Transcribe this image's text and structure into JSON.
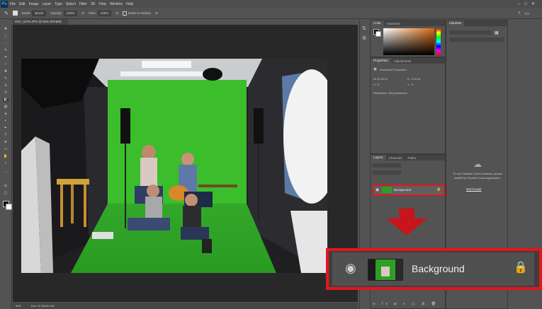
{
  "app": {
    "logo": "Ps"
  },
  "menu": [
    "File",
    "Edit",
    "Image",
    "Layer",
    "Type",
    "Select",
    "Filter",
    "3D",
    "View",
    "Window",
    "Help"
  ],
  "window_controls": [
    "–",
    "□",
    "✕"
  ],
  "options_bar": {
    "mode_label": "Mode:",
    "mode_value": "Brush",
    "opacity_label": "Opacity:",
    "opacity_value": "100%",
    "flow_label": "Flow:",
    "flow_value": "100%",
    "erase_history": "Erase to History"
  },
  "document": {
    "tab_title": "DSC_5275.JPG @ 50% (RGB/8)",
    "zoom": "50%",
    "doc_size": "Doc: 51.9M/51.9M"
  },
  "color_panel": {
    "tabs": [
      "Color",
      "Swatches"
    ]
  },
  "properties_panel": {
    "tabs": [
      "Properties",
      "Adjustments"
    ],
    "heading": "Document Properties",
    "w_label": "W:",
    "w_value": "8.222 in",
    "h_label": "H:",
    "h_value": "5.44 in",
    "x_label": "X:",
    "x_value": "0",
    "y_label": "Y:",
    "y_value": "0",
    "resolution": "Resolution: 300 pixels/inch"
  },
  "layers_panel": {
    "tabs": [
      "Layers",
      "Channels",
      "Paths"
    ],
    "layer_name": "Background"
  },
  "libraries_panel": {
    "tab": "Libraries",
    "message": "To use Creative Cloud Libraries, please install the Creative Cloud Application.",
    "link": "Get it now!"
  },
  "callout": {
    "layer_name": "Background"
  },
  "colors": {
    "highlight": "#e8141b",
    "panel": "#535353",
    "canvas_bg": "#282828",
    "green_screen": "#3bbd2c"
  },
  "icons": [
    "eye-icon",
    "lock-icon",
    "brush-icon",
    "cloud-icon"
  ]
}
